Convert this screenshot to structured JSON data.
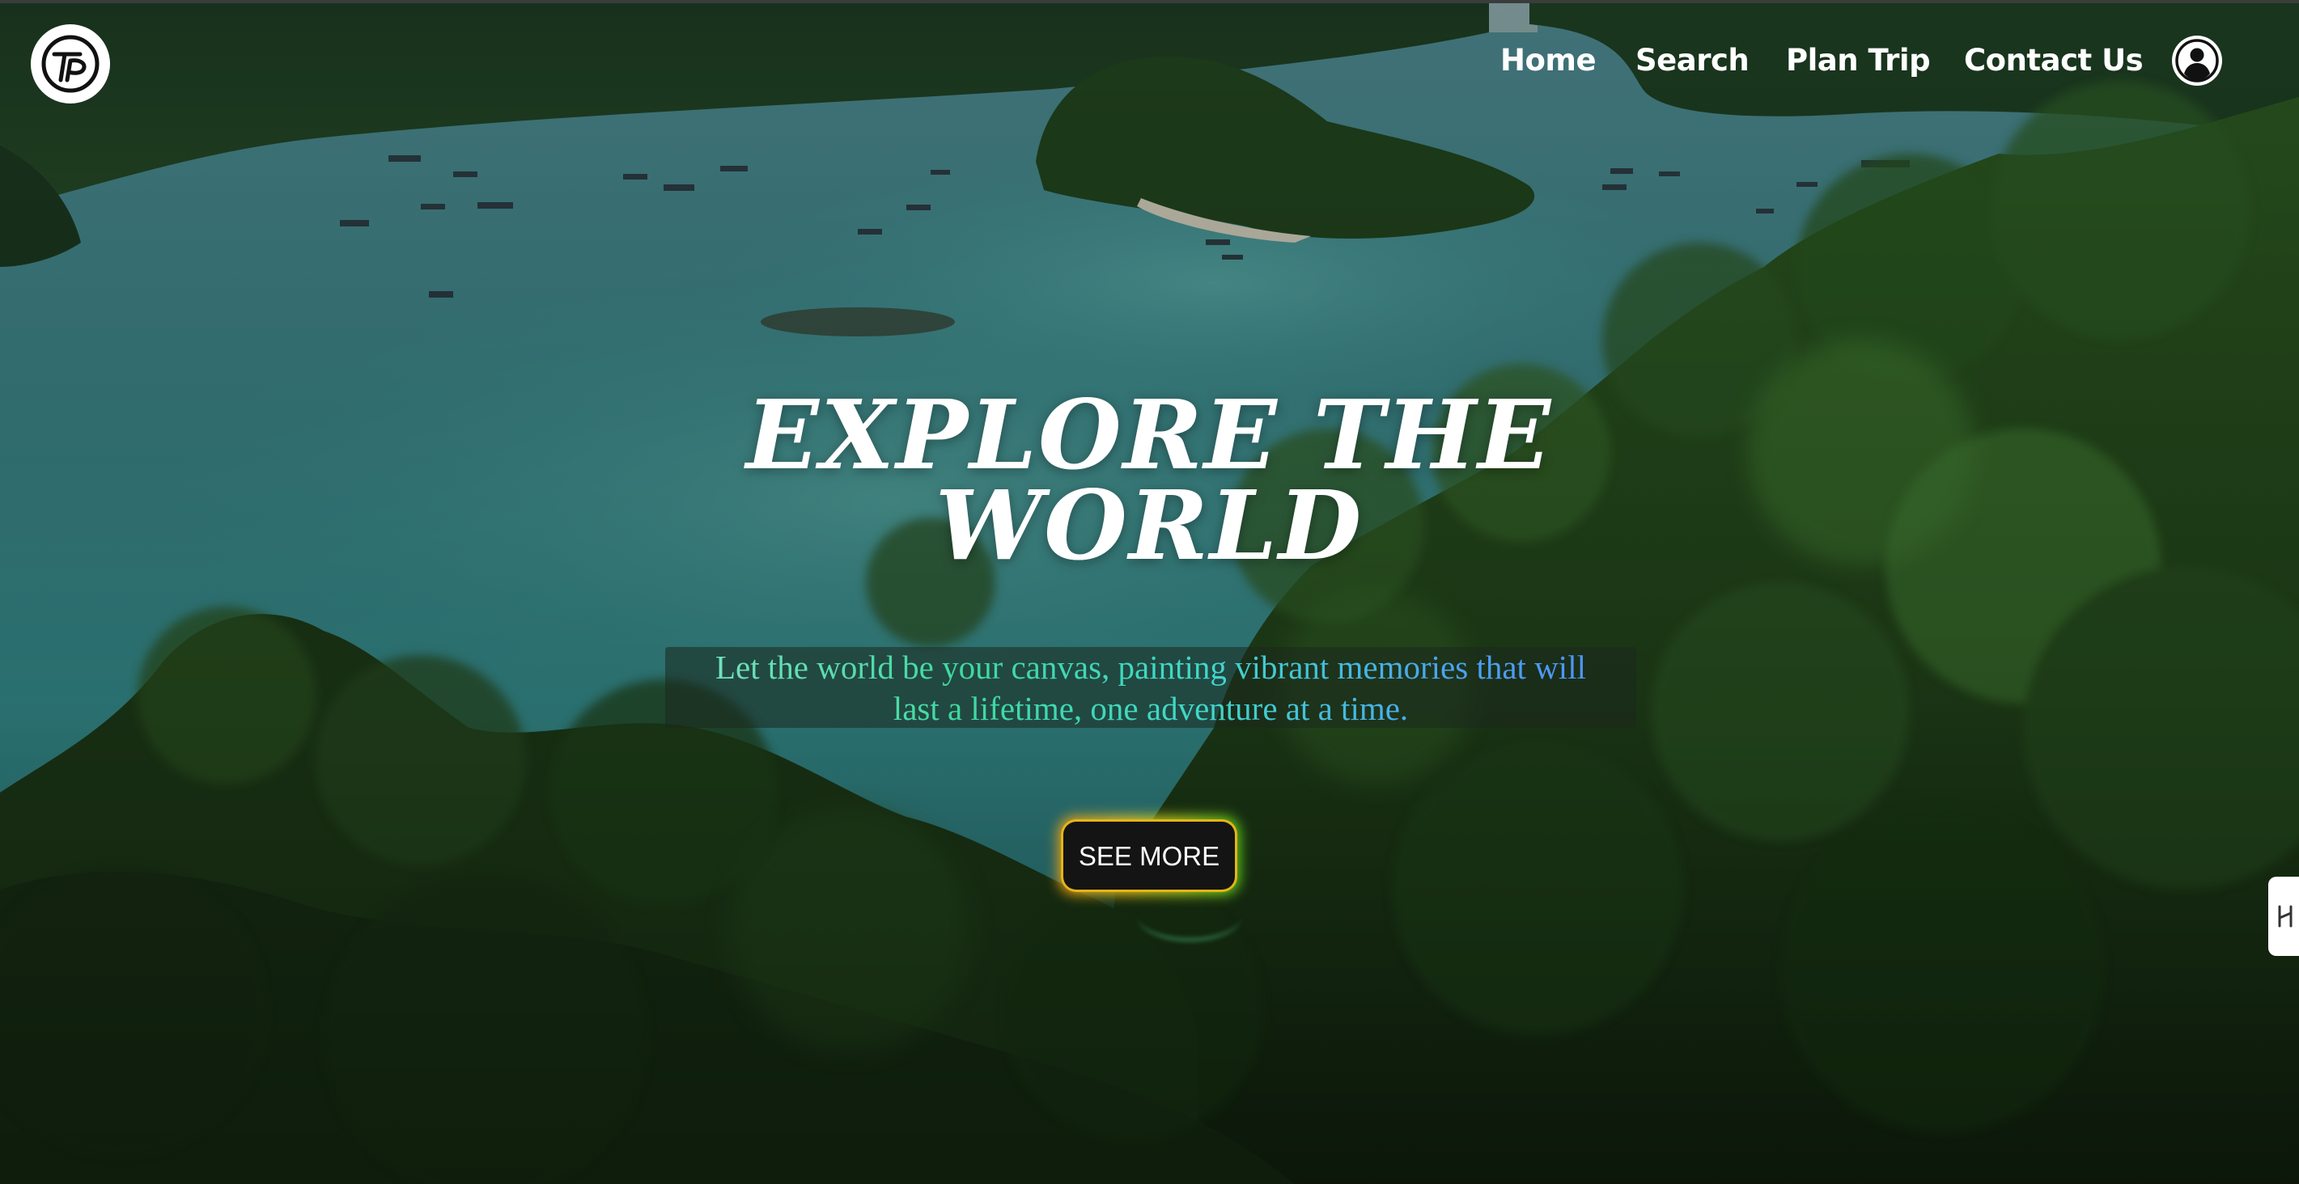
{
  "brand": {
    "logo_icon": "tp-monogram-logo-icon"
  },
  "nav": {
    "items": [
      {
        "label": "Home"
      },
      {
        "label": "Search"
      },
      {
        "label": "Plan Trip"
      },
      {
        "label": "Contact Us"
      }
    ],
    "profile_icon": "user-profile-icon"
  },
  "hero": {
    "title_line1": "EXPLORE THE",
    "title_line2": "WORLD",
    "subtitle_line1": "Let the world be your canvas, painting vibrant memories that will",
    "subtitle_line2": "last a lifetime, one adventure at a time.",
    "cta_label": "SEE MORE"
  },
  "side_widget": {
    "icon": "feedback-tab-icon"
  },
  "colors": {
    "nav_text": "#ffffff",
    "title_text": "#ffffff",
    "subtitle_gradient_start": "#7de3c2",
    "subtitle_gradient_end": "#4f8ff7",
    "button_bg": "#141414",
    "button_glow_start": "#f2a010",
    "button_glow_end": "#5fd81b"
  }
}
